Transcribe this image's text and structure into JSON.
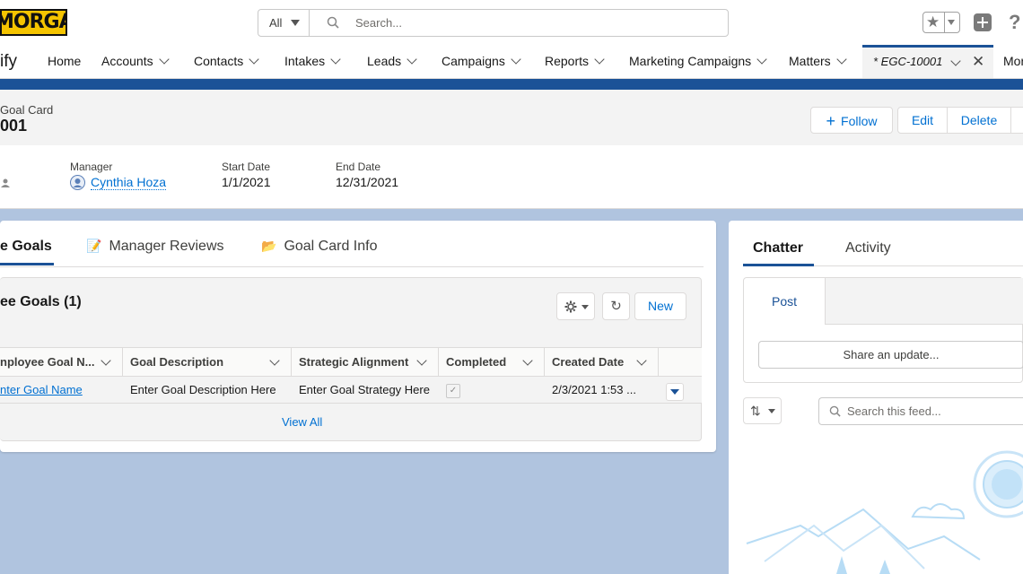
{
  "brand": {
    "logo_text": "MORGAN",
    "app_name": "ify"
  },
  "search": {
    "scope": "All",
    "placeholder": "Search..."
  },
  "nav": {
    "items": [
      "Home",
      "Accounts",
      "Contacts",
      "Intakes",
      "Leads",
      "Campaigns",
      "Reports",
      "Marketing Campaigns",
      "Matters"
    ],
    "active_tab": "* EGC-10001",
    "more": "Mor"
  },
  "record": {
    "object_type": "Goal Card",
    "name": "001",
    "actions": {
      "follow": "Follow",
      "edit": "Edit",
      "delete": "Delete"
    },
    "fields": {
      "manager_label": "Manager",
      "manager_value": "Cynthia Hoza",
      "start_label": "Start Date",
      "start_value": "1/1/2021",
      "end_label": "End Date",
      "end_value": "12/31/2021"
    }
  },
  "main_tabs": {
    "goals": "e Goals",
    "reviews": "Manager Reviews",
    "info": "Goal Card Info"
  },
  "related_list": {
    "title": "ee Goals (1)",
    "new_label": "New",
    "columns": [
      "nployee Goal N...",
      "Goal Description",
      "Strategic Alignment",
      "Completed",
      "Created Date"
    ],
    "rows": [
      {
        "name": "nter Goal Name",
        "description": "Enter Goal Description Here",
        "strategy": "Enter Goal Strategy Here",
        "completed": "✓",
        "created": "2/3/2021 1:53 ..."
      }
    ],
    "view_all": "View All"
  },
  "side": {
    "tab_chatter": "Chatter",
    "tab_activity": "Activity",
    "post_label": "Post",
    "share_placeholder": "Share an update...",
    "feed_search_placeholder": "Search this feed...",
    "sort_glyph": "⇅"
  },
  "colors": {
    "brand_blue": "#1b5297",
    "link": "#0070d2",
    "logo_yellow": "#f5c400",
    "page_bg": "#b0c4df"
  }
}
